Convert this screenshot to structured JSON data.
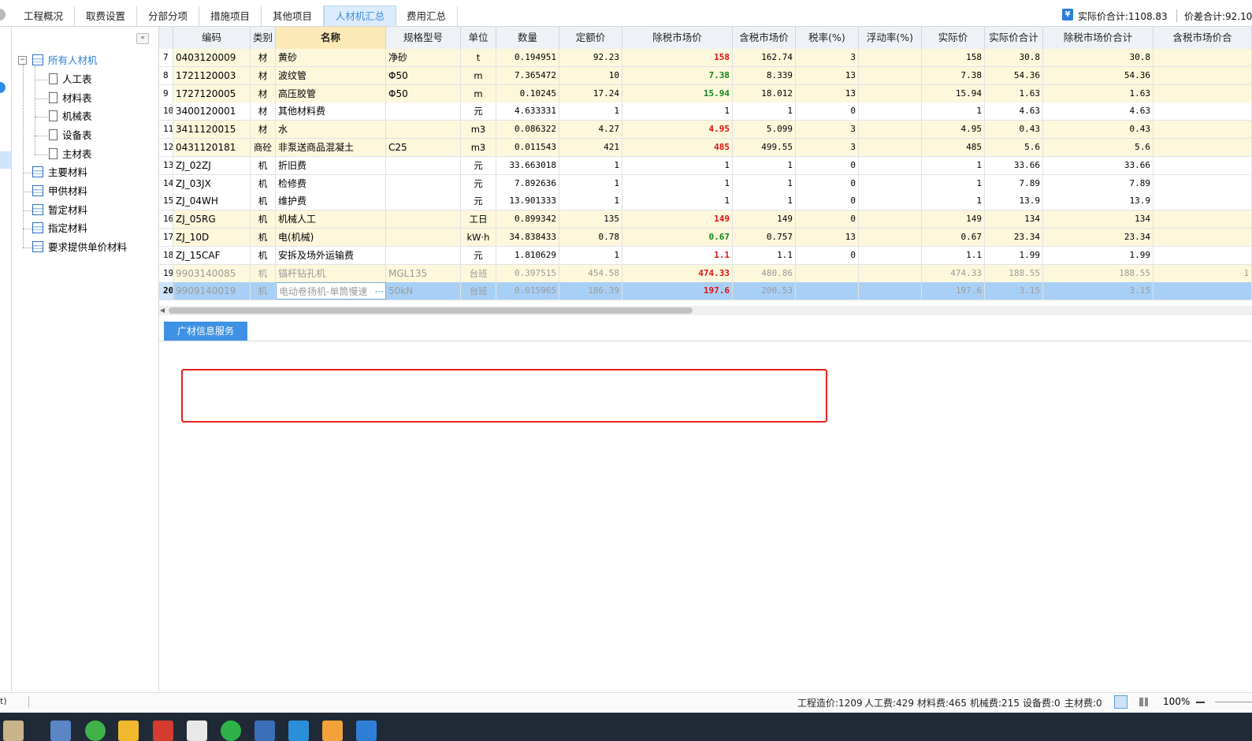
{
  "top_tabs": [
    {
      "label": "工程概况"
    },
    {
      "label": "取费设置"
    },
    {
      "label": "分部分项"
    },
    {
      "label": "措施项目"
    },
    {
      "label": "其他项目"
    },
    {
      "label": "人材机汇总"
    },
    {
      "label": "费用汇总"
    }
  ],
  "active_tab": "人材机汇总",
  "summary": {
    "actual_total": "实际价合计:1108.83",
    "diff_total": "价差合计:92.10"
  },
  "sidebar": {
    "root": "所有人材机",
    "children": [
      "人工表",
      "材料表",
      "机械表",
      "设备表",
      "主材表"
    ],
    "items": [
      "主要材料",
      "甲供材料",
      "暂定材料",
      "指定材料",
      "要求提供单价材料"
    ]
  },
  "columns": [
    "编码",
    "类别",
    "名称",
    "规格型号",
    "单位",
    "数量",
    "定额价",
    "除税市场价",
    "含税市场价",
    "税率(%)",
    "浮动率(%)",
    "实际价",
    "实际价合计",
    "除税市场价合计",
    "含税市场价合"
  ],
  "rows": [
    {
      "n": "7",
      "code": "0403120009",
      "type": "材",
      "name": "黄砂",
      "spec": "净砂",
      "unit": "t",
      "qty": "0.194951",
      "quota": "92.23",
      "mkt": "158",
      "mkt_color": "red",
      "tax_mkt": "162.74",
      "rate": "3",
      "float": "",
      "actual": "158",
      "actual_total": "30.8",
      "mkt_total": "30.8"
    },
    {
      "n": "8",
      "code": "1721120003",
      "type": "材",
      "name": "波纹管",
      "spec": "Φ50",
      "unit": "m",
      "qty": "7.365472",
      "quota": "10",
      "mkt": "7.38",
      "mkt_color": "green",
      "tax_mkt": "8.339",
      "rate": "13",
      "float": "",
      "actual": "7.38",
      "actual_total": "54.36",
      "mkt_total": "54.36"
    },
    {
      "n": "9",
      "code": "1727120005",
      "type": "材",
      "name": "高压胶管",
      "spec": "Φ50",
      "unit": "m",
      "qty": "0.10245",
      "quota": "17.24",
      "mkt": "15.94",
      "mkt_color": "green",
      "tax_mkt": "18.012",
      "rate": "13",
      "float": "",
      "actual": "15.94",
      "actual_total": "1.63",
      "mkt_total": "1.63"
    },
    {
      "n": "10",
      "code": "3400120001",
      "type": "材",
      "name": "其他材料费",
      "spec": "",
      "unit": "元",
      "qty": "4.633331",
      "quota": "1",
      "mkt": "1",
      "mkt_color": "",
      "tax_mkt": "1",
      "rate": "0",
      "float": "",
      "actual": "1",
      "actual_total": "4.63",
      "mkt_total": "4.63"
    },
    {
      "n": "11",
      "code": "3411120015",
      "type": "材",
      "name": "水",
      "spec": "",
      "unit": "m3",
      "qty": "0.086322",
      "quota": "4.27",
      "mkt": "4.95",
      "mkt_color": "red",
      "tax_mkt": "5.099",
      "rate": "3",
      "float": "",
      "actual": "4.95",
      "actual_total": "0.43",
      "mkt_total": "0.43"
    },
    {
      "n": "12",
      "code": "0431120181",
      "type": "商砼",
      "name": "非泵送商品混凝土",
      "spec": "C25",
      "unit": "m3",
      "qty": "0.011543",
      "quota": "421",
      "mkt": "485",
      "mkt_color": "red",
      "tax_mkt": "499.55",
      "rate": "3",
      "float": "",
      "actual": "485",
      "actual_total": "5.6",
      "mkt_total": "5.6"
    },
    {
      "n": "13",
      "code": "ZJ_02ZJ",
      "type": "机",
      "name": "折旧费",
      "spec": "",
      "unit": "元",
      "qty": "33.663018",
      "quota": "1",
      "mkt": "1",
      "mkt_color": "",
      "tax_mkt": "1",
      "rate": "0",
      "float": "",
      "actual": "1",
      "actual_total": "33.66",
      "mkt_total": "33.66"
    },
    {
      "n": "14",
      "code": "ZJ_03JX",
      "type": "机",
      "name": "检修费",
      "spec": "",
      "unit": "元",
      "qty": "7.892636",
      "quota": "1",
      "mkt": "1",
      "mkt_color": "",
      "tax_mkt": "1",
      "rate": "0",
      "float": "",
      "actual": "1",
      "actual_total": "7.89",
      "mkt_total": "7.89"
    },
    {
      "n": "15",
      "code": "ZJ_04WH",
      "type": "机",
      "name": "维护费",
      "spec": "",
      "unit": "元",
      "qty": "13.901333",
      "quota": "1",
      "mkt": "1",
      "mkt_color": "",
      "tax_mkt": "1",
      "rate": "0",
      "float": "",
      "actual": "1",
      "actual_total": "13.9",
      "mkt_total": "13.9"
    },
    {
      "n": "16",
      "code": "ZJ_05RG",
      "type": "机",
      "name": "机械人工",
      "spec": "",
      "unit": "工日",
      "qty": "0.899342",
      "quota": "135",
      "mkt": "149",
      "mkt_color": "red",
      "tax_mkt": "149",
      "rate": "0",
      "float": "",
      "actual": "149",
      "actual_total": "134",
      "mkt_total": "134"
    },
    {
      "n": "17",
      "code": "ZJ_10D",
      "type": "机",
      "name": "电(机械)",
      "spec": "",
      "unit": "kW·h",
      "qty": "34.838433",
      "quota": "0.78",
      "mkt": "0.67",
      "mkt_color": "green",
      "tax_mkt": "0.757",
      "rate": "13",
      "float": "",
      "actual": "0.67",
      "actual_total": "23.34",
      "mkt_total": "23.34"
    },
    {
      "n": "18",
      "code": "ZJ_15CAF",
      "type": "机",
      "name": "安拆及场外运输费",
      "spec": "",
      "unit": "元",
      "qty": "1.810629",
      "quota": "1",
      "mkt": "1.1",
      "mkt_color": "red",
      "tax_mkt": "1.1",
      "rate": "0",
      "float": "",
      "actual": "1.1",
      "actual_total": "1.99",
      "mkt_total": "1.99"
    },
    {
      "n": "19",
      "code": "9903140085",
      "type": "机",
      "name": "锚杆钻孔机",
      "spec": "MGL135",
      "unit": "台班",
      "qty": "0.397515",
      "quota": "454.58",
      "mkt": "474.33",
      "mkt_color": "red",
      "tax_mkt": "480.86",
      "rate": "",
      "float": "",
      "actual": "474.33",
      "actual_total": "188.55",
      "mkt_total": "188.55",
      "dim": true,
      "last": "1"
    },
    {
      "n": "20",
      "code": "9909140019",
      "type": "机",
      "name": "电动卷扬机-单筒慢速",
      "spec": "50kN",
      "unit": "台班",
      "qty": "0.015965",
      "quota": "186.39",
      "mkt": "197.6",
      "mkt_color": "red",
      "tax_mkt": "200.53",
      "rate": "",
      "float": "",
      "actual": "197.6",
      "actual_total": "3.15",
      "mkt_total": "3.15",
      "dim": true,
      "selected": true
    }
  ],
  "lower_tab": "广材信息服务",
  "status": {
    "left": "t)",
    "project_cost": "工程造价:1209",
    "labor": "人工费:429",
    "material": "材料费:465",
    "machine": "机械费:215",
    "equipment": "设备费:0",
    "main_material": "主材费:0",
    "zoom": "100%"
  },
  "colors": {
    "accent": "#3f92e3",
    "row_yellow": "#fdf7dc",
    "row_selected": "#a8d0f6",
    "red_value": "#e01010",
    "green_value": "#10891a",
    "highlight_box": "#e8211c"
  }
}
